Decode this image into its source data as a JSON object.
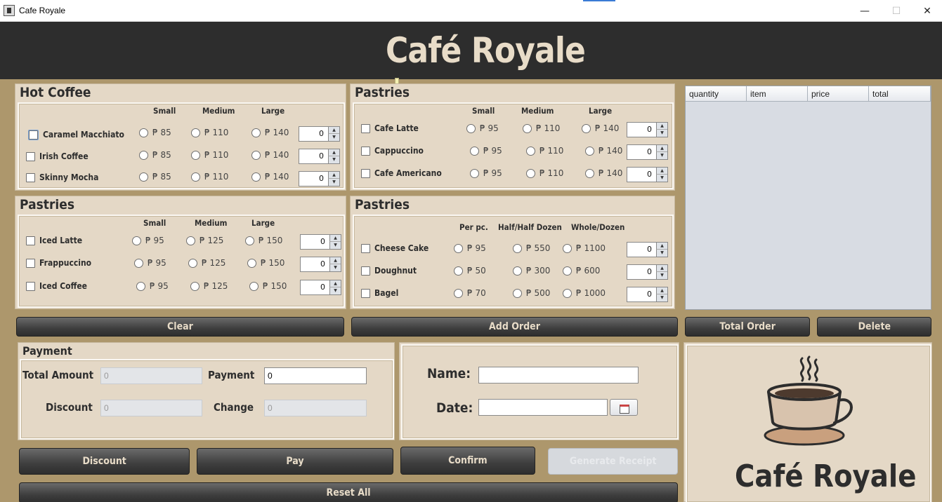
{
  "window": {
    "title": "Cafe Royale",
    "minimize": "—",
    "maximize": "☐",
    "close": "✕"
  },
  "header": {
    "title": "Café Royale"
  },
  "hot_coffee": {
    "title": "Hot Coffee",
    "sizes": [
      "Small",
      "Medium",
      "Large"
    ],
    "items": [
      {
        "name": "Caramel Macchiato",
        "prices": [
          "₱ 85",
          "₱ 110",
          "₱ 140"
        ],
        "qty": "0"
      },
      {
        "name": "Irish Coffee",
        "prices": [
          "₱ 85",
          "₱ 110",
          "₱ 140"
        ],
        "qty": "0"
      },
      {
        "name": "Skinny Mocha",
        "prices": [
          "₱ 85",
          "₱ 110",
          "₱ 140"
        ],
        "qty": "0"
      }
    ]
  },
  "pastries_top": {
    "title": "Pastries",
    "sizes": [
      "Small",
      "Medium",
      "Large"
    ],
    "items": [
      {
        "name": "Cafe Latte",
        "prices": [
          "₱ 95",
          "₱ 110",
          "₱ 140"
        ],
        "qty": "0"
      },
      {
        "name": "Cappuccino",
        "prices": [
          "₱ 95",
          "₱ 110",
          "₱ 140"
        ],
        "qty": "0"
      },
      {
        "name": "Cafe Americano",
        "prices": [
          "₱ 95",
          "₱ 110",
          "₱ 140"
        ],
        "qty": "0"
      }
    ]
  },
  "pastries_cold": {
    "title": "Pastries",
    "sizes": [
      "Small",
      "Medium",
      "Large"
    ],
    "items": [
      {
        "name": "Iced Latte",
        "prices": [
          "₱ 95",
          "₱ 125",
          "₱ 150"
        ],
        "qty": "0"
      },
      {
        "name": "Frappuccino",
        "prices": [
          "₱ 95",
          "₱ 125",
          "₱ 150"
        ],
        "qty": "0"
      },
      {
        "name": "Iced Coffee",
        "prices": [
          "₱ 95",
          "₱ 125",
          "₱ 150"
        ],
        "qty": "0"
      }
    ]
  },
  "pastries_bake": {
    "title": "Pastries",
    "sizes": [
      "Per pc.",
      "Half/Half Dozen",
      "Whole/Dozen"
    ],
    "items": [
      {
        "name": "Cheese Cake",
        "prices": [
          "₱ 95",
          "₱ 550",
          "₱ 1100"
        ],
        "qty": "0"
      },
      {
        "name": "Doughnut",
        "prices": [
          "₱ 50",
          "₱ 300",
          "₱ 600"
        ],
        "qty": "0"
      },
      {
        "name": "Bagel",
        "prices": [
          "₱ 70",
          "₱ 500",
          "₱ 1000"
        ],
        "qty": "0"
      }
    ]
  },
  "order_table": {
    "columns": [
      "quantity",
      "item",
      "price",
      "total"
    ],
    "rows": []
  },
  "buttons": {
    "clear": "Clear",
    "add_order": "Add Order",
    "total_order": "Total Order",
    "delete": "Delete",
    "discount": "Discount",
    "pay": "Pay",
    "confirm": "Confirm",
    "generate_receipt": "Generate Receipt",
    "reset_all": "Reset All"
  },
  "payment": {
    "title": "Payment",
    "total_amount_label": "Total Amount",
    "total_amount": "0",
    "payment_label": "Payment",
    "payment_value": "0",
    "discount_label": "Discount",
    "discount_value": "0",
    "change_label": "Change",
    "change_value": "0"
  },
  "customer": {
    "name_label": "Name:",
    "name_value": "",
    "date_label": "Date:",
    "date_value": ""
  },
  "logo": {
    "title": "Café Royale"
  },
  "colors": {
    "background": "#ad976c",
    "panel": "#e4d8c6",
    "header": "#2d2d2d",
    "accent_text": "#e8dcc8"
  },
  "icons": [
    "app-icon",
    "calendar-icon",
    "coffee-cup-logo-icon"
  ]
}
